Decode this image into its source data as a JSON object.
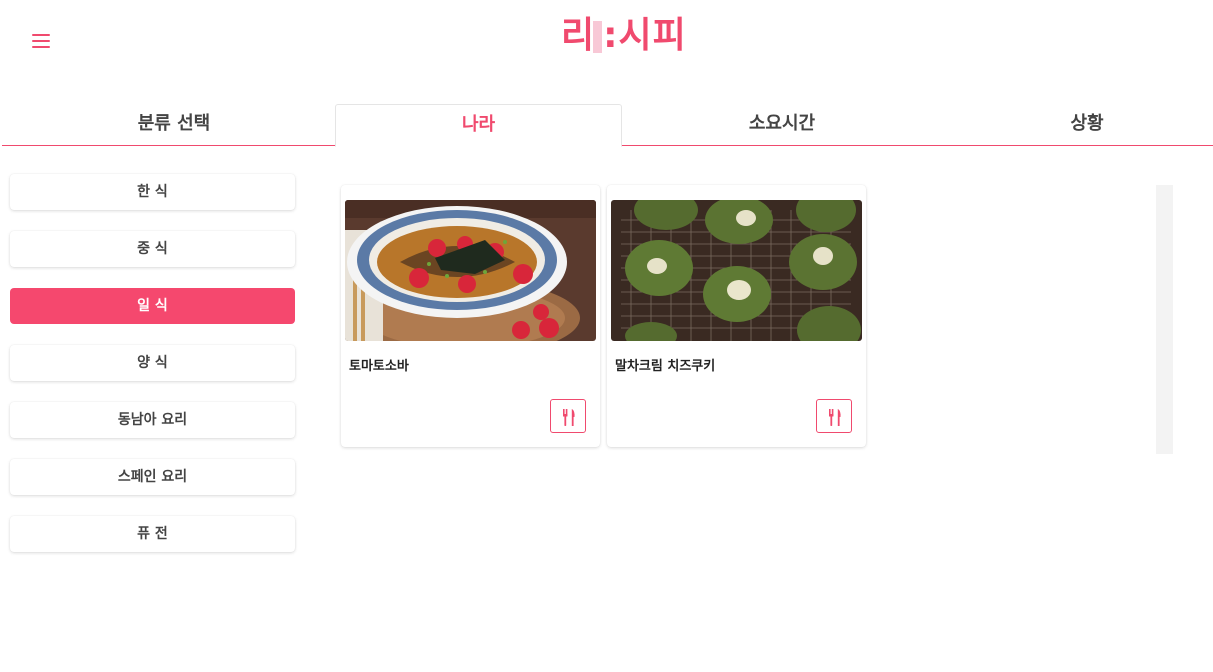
{
  "header": {
    "menu_icon": "hamburger-icon",
    "logo_left": "리",
    "logo_right": ":시피",
    "accent_color": "#f04a6e"
  },
  "tabs": [
    {
      "label": "분류 선택"
    },
    {
      "label": "나라",
      "active": true
    },
    {
      "label": "소요시간"
    },
    {
      "label": "상황"
    }
  ],
  "sidebar": {
    "items": [
      {
        "label": "한 식"
      },
      {
        "label": "중 식"
      },
      {
        "label": "일 식",
        "active": true
      },
      {
        "label": "양 식"
      },
      {
        "label": "동남아 요리"
      },
      {
        "label": "스페인 요리"
      },
      {
        "label": "퓨 전"
      }
    ]
  },
  "recipes": [
    {
      "title": "토마토소바",
      "action_icon": "utensils-icon"
    },
    {
      "title": "말차크림 치즈쿠키",
      "action_icon": "utensils-icon"
    }
  ]
}
